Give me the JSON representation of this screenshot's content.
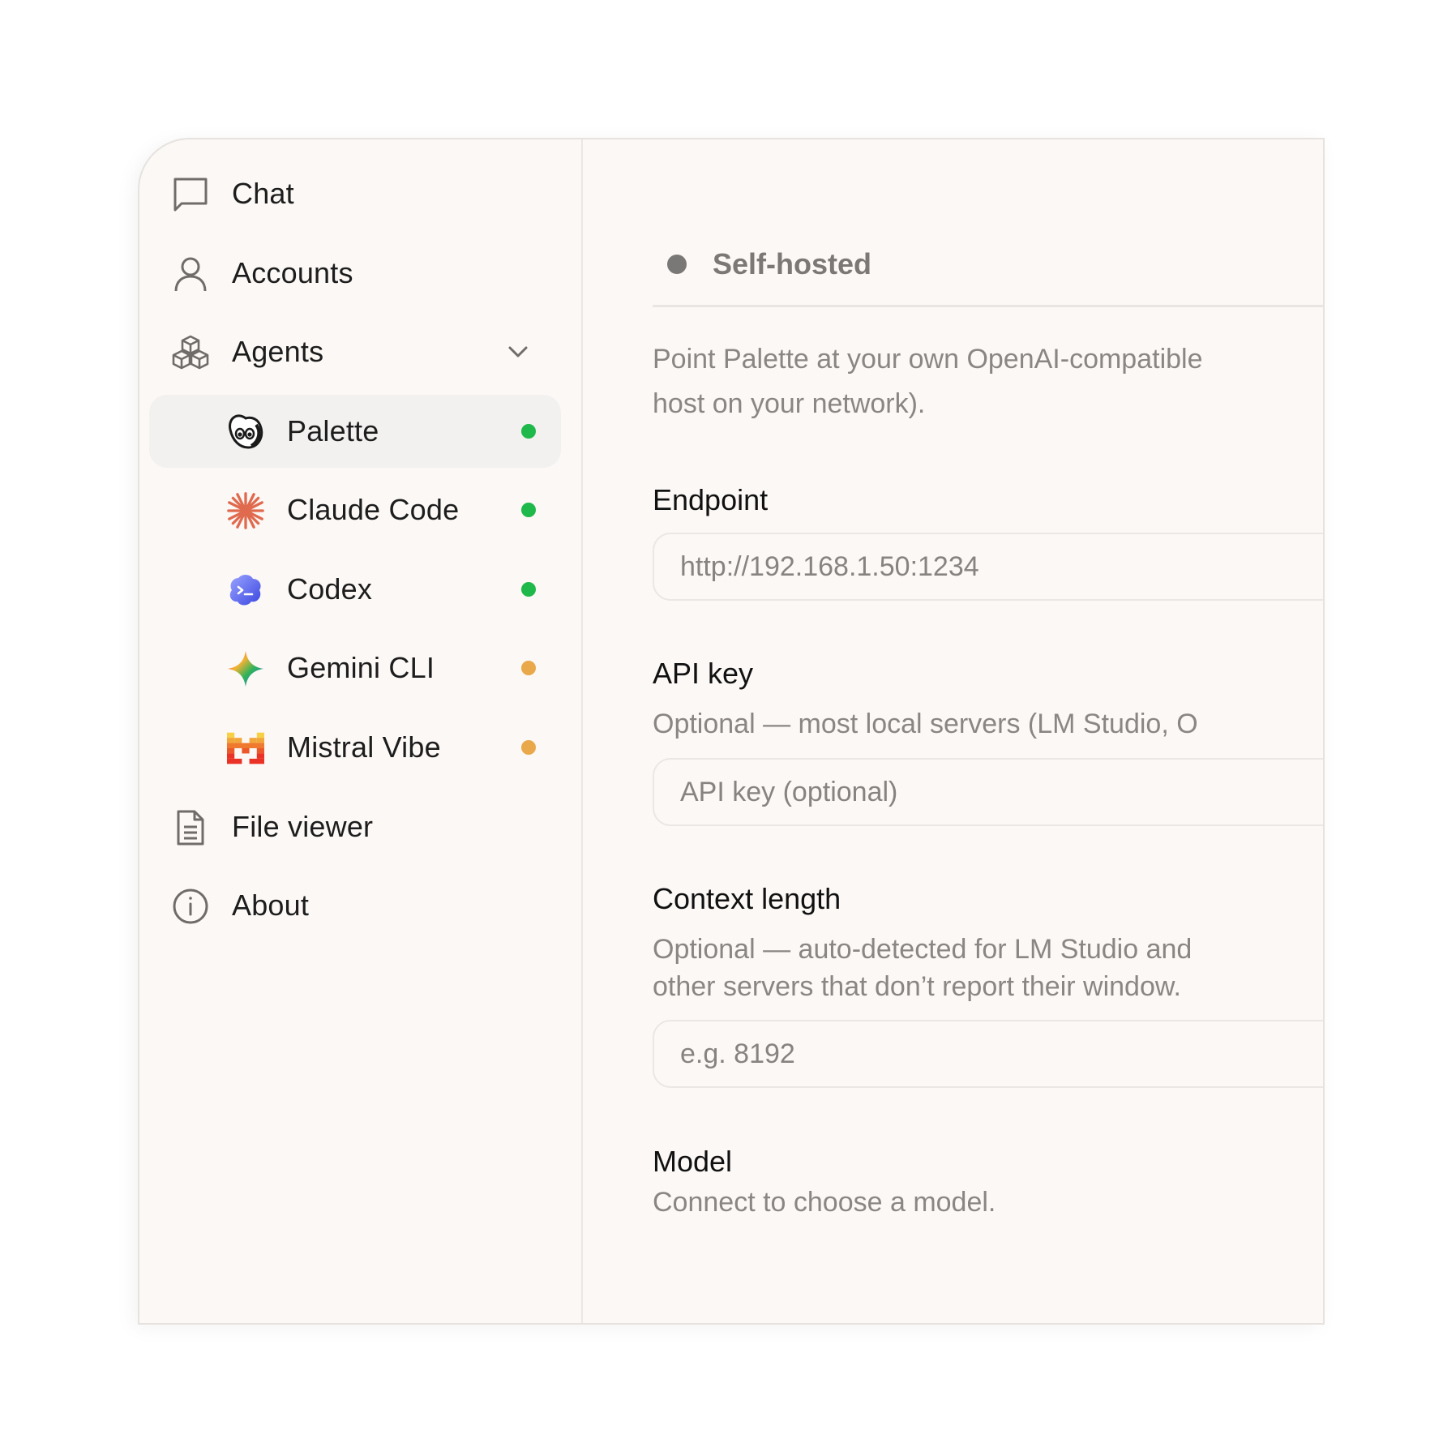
{
  "sidebar": {
    "items": [
      {
        "label": "Chat",
        "icon": "chat-bubble-icon"
      },
      {
        "label": "Accounts",
        "icon": "person-icon"
      },
      {
        "label": "Agents",
        "icon": "cubes-icon"
      },
      {
        "label": "File viewer",
        "icon": "document-icon"
      },
      {
        "label": "About",
        "icon": "info-icon"
      }
    ],
    "agents": [
      {
        "label": "Palette",
        "icon": "palette-face-icon",
        "status": "online",
        "status_color": "#1fb84a"
      },
      {
        "label": "Claude Code",
        "icon": "claude-starburst-icon",
        "status": "online",
        "status_color": "#1fb84a"
      },
      {
        "label": "Codex",
        "icon": "codex-cloud-icon",
        "status": "online",
        "status_color": "#1fb84a"
      },
      {
        "label": "Gemini CLI",
        "icon": "gemini-sparkle-icon",
        "status": "warning",
        "status_color": "#e9a84a"
      },
      {
        "label": "Mistral Vibe",
        "icon": "mistral-pixel-icon",
        "status": "warning",
        "status_color": "#e9a84a"
      }
    ]
  },
  "main": {
    "mode_label": "Self-hosted",
    "description_line1": "Point Palette at your own OpenAI-compatible",
    "description_line2": "host on your network).",
    "endpoint": {
      "label": "Endpoint",
      "placeholder": "http://192.168.1.50:1234"
    },
    "api_key": {
      "label": "API key",
      "help": "Optional — most local servers (LM Studio, O",
      "placeholder": "API key (optional)"
    },
    "context_length": {
      "label": "Context length",
      "help_line1": "Optional — auto-detected for LM Studio and",
      "help_line2": "other servers that don’t report their window.",
      "placeholder": "e.g. 8192"
    },
    "model": {
      "label": "Model",
      "help": "Connect to choose a model."
    }
  }
}
